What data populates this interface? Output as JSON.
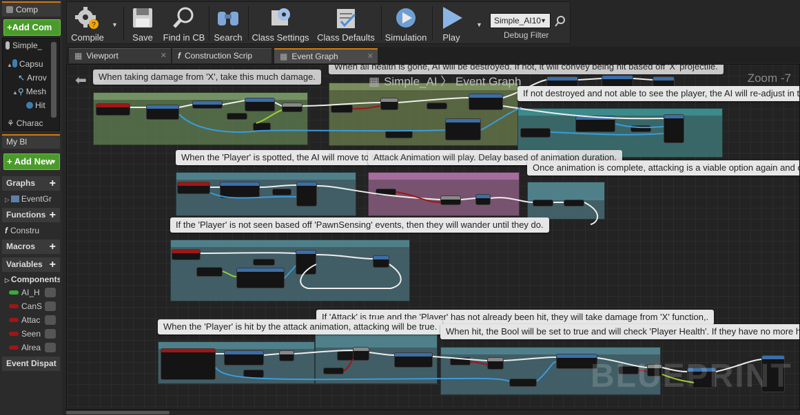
{
  "left_panel": {
    "components_tab": "Comp",
    "add_component": "+Add Com",
    "self_row": "Simple_",
    "tree": [
      "Capsu",
      "Arrov",
      "Mesh",
      "Hit",
      "Charac"
    ],
    "mybp_tab": "My Bl",
    "add_new": "+ Add New",
    "sections": {
      "graphs": "Graphs",
      "event_graph_item": "EventGr",
      "functions": "Functions",
      "construction_item": "Constru",
      "macros": "Macros",
      "variables": "Variables",
      "components": "Components",
      "event_dispatchers": "Event Dispat"
    },
    "variables": [
      {
        "name": "AI_H",
        "color": "#3aaa3a"
      },
      {
        "name": "CanS",
        "color": "#a01616"
      },
      {
        "name": "Attac",
        "color": "#a01616"
      },
      {
        "name": "Seen",
        "color": "#a01616"
      },
      {
        "name": "Alrea",
        "color": "#a01616"
      }
    ]
  },
  "toolbar": {
    "compile": "Compile",
    "save": "Save",
    "find": "Find in CB",
    "search": "Search",
    "class_settings": "Class Settings",
    "class_defaults": "Class Defaults",
    "simulation": "Simulation",
    "play": "Play",
    "debug_select": "Simple_AI10",
    "debug_filter": "Debug Filter"
  },
  "tabs": [
    {
      "label": "Viewport",
      "prefix": ""
    },
    {
      "label": "Construction Scrip",
      "prefix": "f"
    },
    {
      "label": "Event Graph",
      "prefix": ""
    }
  ],
  "graph": {
    "breadcrumb": "Simple_AI  〉 Event Graph",
    "zoom": "Zoom -7",
    "watermark": "BLUEPRINT",
    "comments": [
      {
        "text": "When taking damage from 'X', take this much damage."
      },
      {
        "text": "When all health is gone, AI will be destroyed. If not, it will convey being hit based off 'X' projectile."
      },
      {
        "text": "If not destroyed and not able to see the player, the AI will re-adjust in the direction of taking the shot from the player."
      },
      {
        "text": "When the 'Player' is spotted, the AI will move to their location based off 'PawnSensing' region."
      },
      {
        "text": "Attack Animation will play. Delay based of animation duration."
      },
      {
        "text": "Once animation is complete, attacking is a viable option again and c"
      },
      {
        "text": "If the 'Player' is not seen based off 'PawnSensing' events, then they will wander until they do."
      },
      {
        "text": "If 'Attack' is true and the 'Player' has not already been hit, they will take damage from 'X' function,."
      },
      {
        "text": "When the 'Player' is hit by the attack animation, attacking will be true."
      },
      {
        "text": "When hit, the Bool will be set to true and will check 'Player Health'. If they have no more he"
      }
    ]
  }
}
